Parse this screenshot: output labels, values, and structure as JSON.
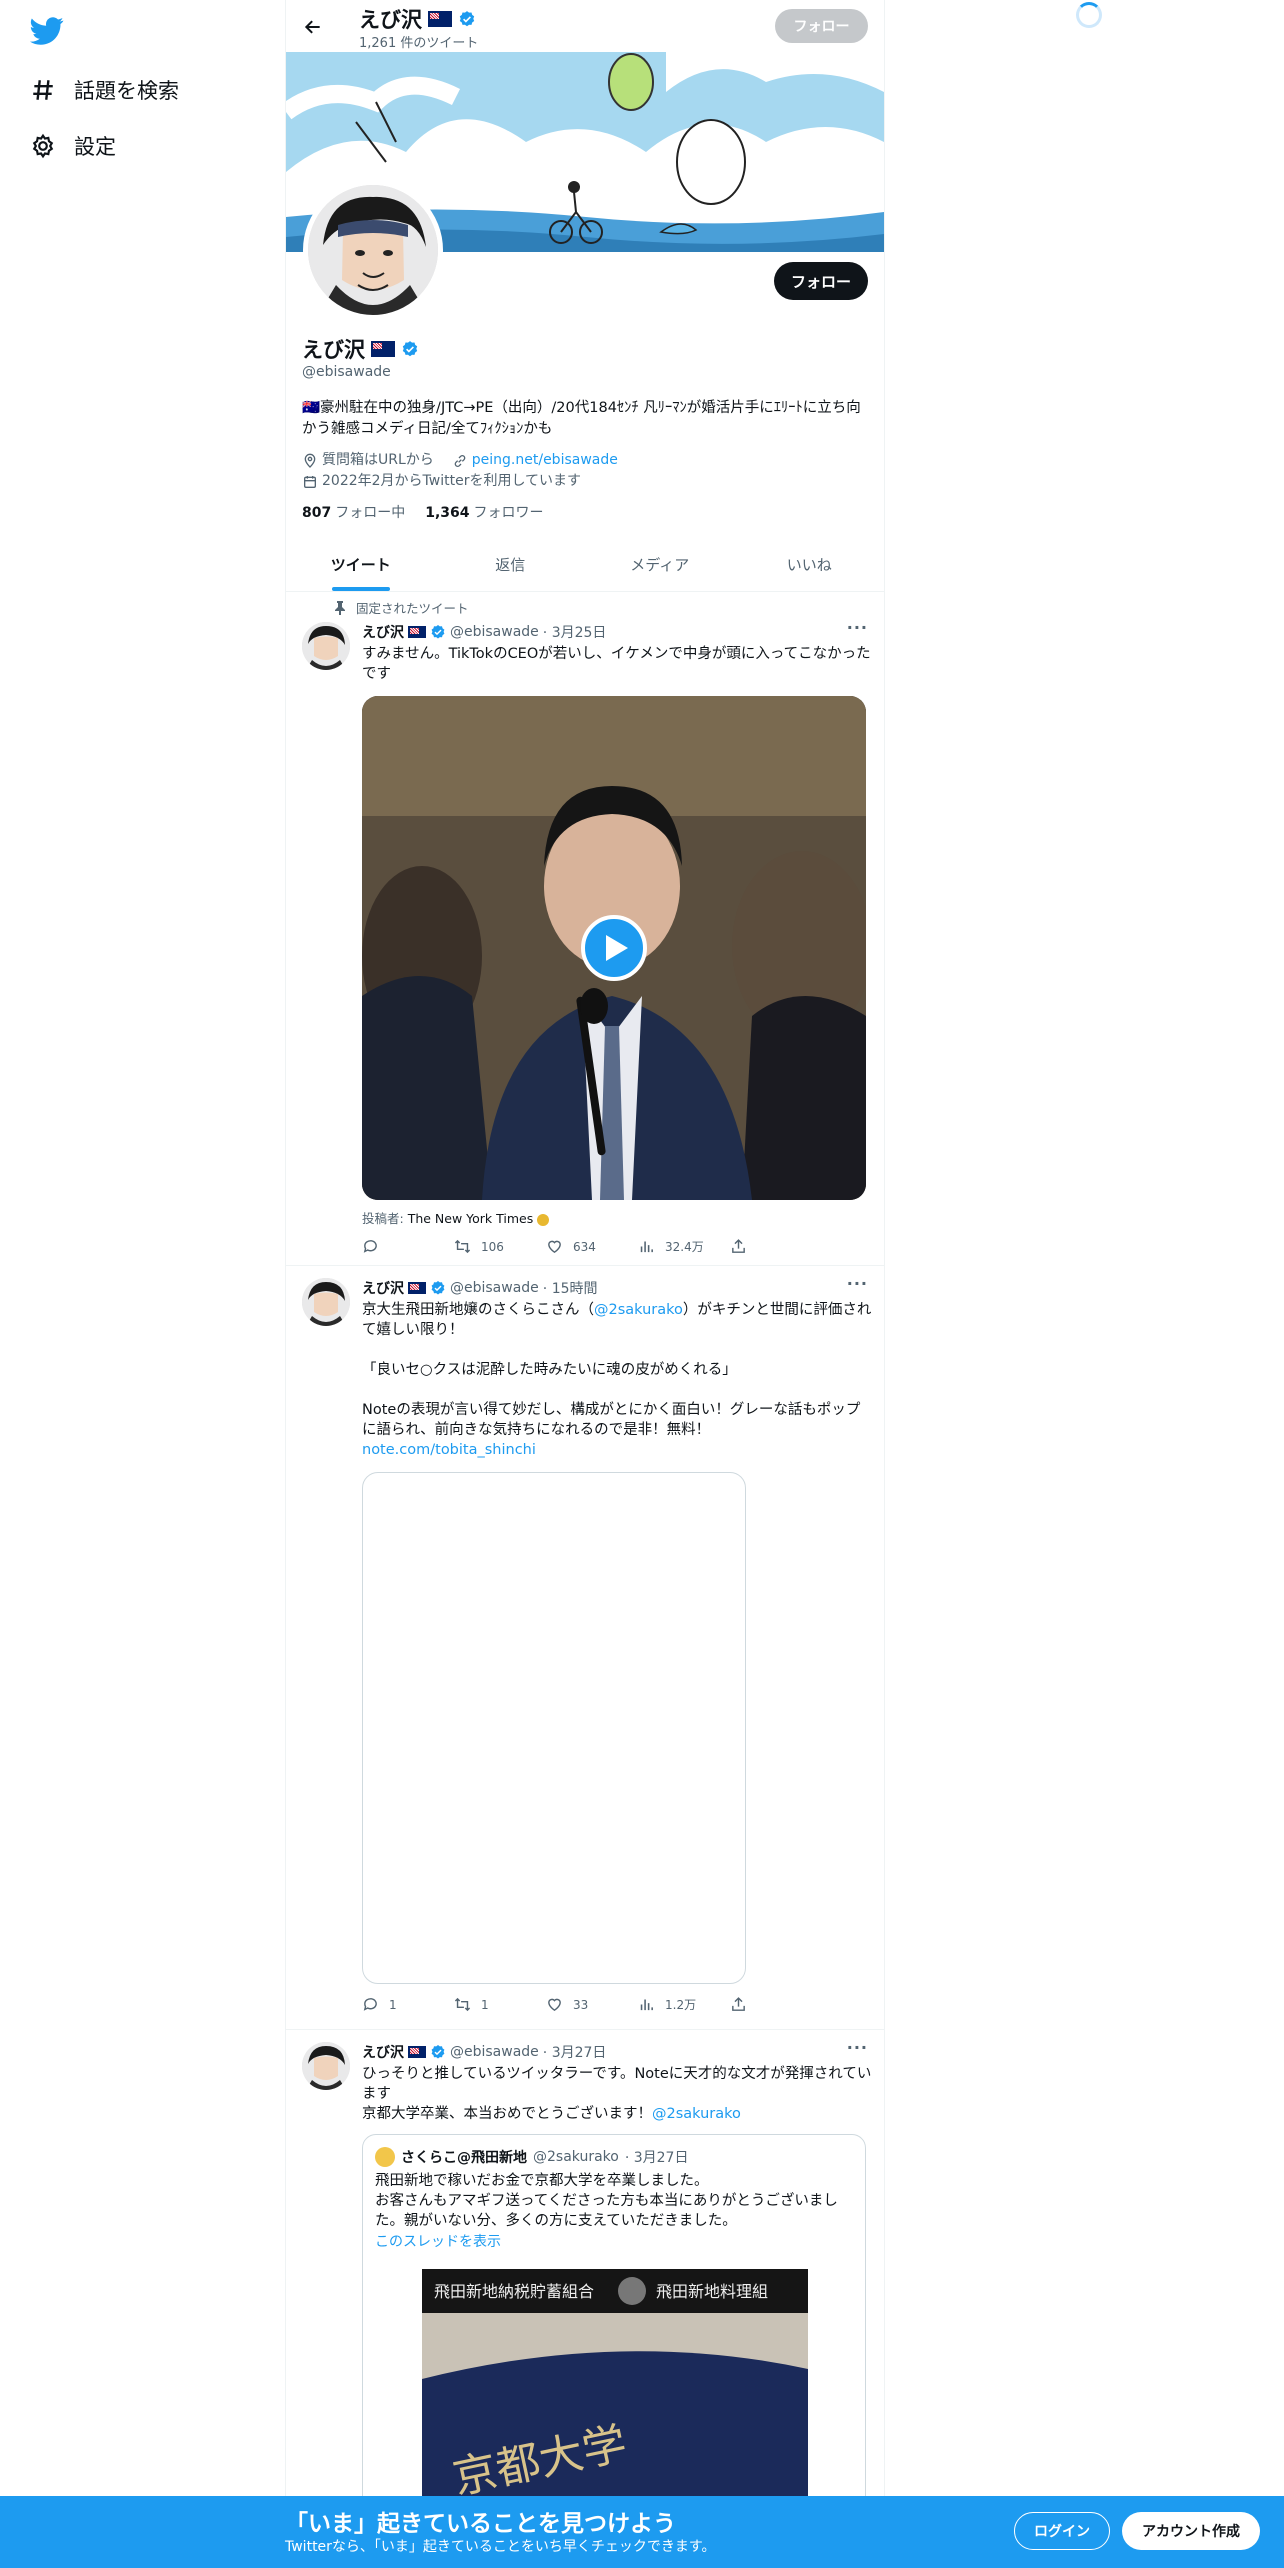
{
  "nav": {
    "explore_label": "話題を検索",
    "settings_label": "設定",
    "logo_icon": "twitter-bird-icon"
  },
  "header": {
    "name": "えび沢",
    "tweet_count": "1,261 件のツイート",
    "follow_label": "フォロー"
  },
  "profile": {
    "name": "えび沢",
    "handle": "@ebisawade",
    "bio": "🇦🇺豪州駐在中の独身/JTC→PE（出向）/20代184ｾﾝﾁ 凡ﾘｰﾏﾝが婚活片手にｴﾘｰﾄに立ち向かう雑感コメディ日記/全てﾌｨｸｼｮﾝかも",
    "location": "質問箱はURLから",
    "link": "peing.net/ebisawade",
    "joined": "2022年2月からTwitterを利用しています",
    "following_count": "807",
    "following_label": "フォロー中",
    "followers_count": "1,364",
    "followers_label": "フォロワー",
    "follow_label": "フォロー"
  },
  "tabs": [
    {
      "label": "ツイート",
      "active": true
    },
    {
      "label": "返信",
      "active": false
    },
    {
      "label": "メディア",
      "active": false
    },
    {
      "label": "いいね",
      "active": false
    }
  ],
  "tweets": [
    {
      "pinned_label": "固定されたツイート",
      "name": "えび沢",
      "handle": "@ebisawade",
      "time": "· 3月25日",
      "text": "すみません。TikTokのCEOが若いし、イケメンで中身が頭に入ってこなかったです",
      "byline_prefix": "投稿者:",
      "byline_source": "The New York Times",
      "replies": "",
      "retweets": "106",
      "likes": "634",
      "views": "32.4万"
    },
    {
      "name": "えび沢",
      "handle": "@ebisawade",
      "time": "· 15時間",
      "text_a": "京大生飛田新地嬢のさくらこさん（",
      "mention": "@2sakurako",
      "text_b": "）がキチンと世間に評価されて嬉しい限り！\n\n「良いセ○クスは泥酔した時みたいに魂の皮がめくれる」\n\nNoteの表現が言い得て妙だし、構成がとにかく面白い！グレーな話もポップに語られ、前向きな気持ちになれるので是非！無料！",
      "link": "note.com/tobita_shinchi",
      "replies": "1",
      "retweets": "1",
      "likes": "33",
      "views": "1.2万"
    },
    {
      "name": "えび沢",
      "handle": "@ebisawade",
      "time": "· 3月27日",
      "text": "ひっそりと推しているツイッタラーです。Noteに天才的な文才が発揮されています\n京都大学卒業、本当おめでとうございます！",
      "mention": "@2sakurako",
      "quote": {
        "name": "さくらこ@飛田新地",
        "handle": "@2sakurako",
        "time": "· 3月27日",
        "text": "飛田新地で稼いだお金で京都大学を卒業しました。\nお客さんもアマギフ送ってくださった方も本当にありがとうございました。親がいない分、多くの方に支えていただきました。",
        "thread_label": "このスレッドを表示"
      }
    }
  ],
  "bottom": {
    "title": "「いま」起きていることを見つけよう",
    "subtitle": "Twitterなら、「いま」起きていることをいち早くチェックできます。",
    "login_label": "ログイン",
    "signup_label": "アカウント作成"
  },
  "colors": {
    "accent": "#1d9bf0",
    "text": "#0f1419",
    "muted": "#536471"
  }
}
